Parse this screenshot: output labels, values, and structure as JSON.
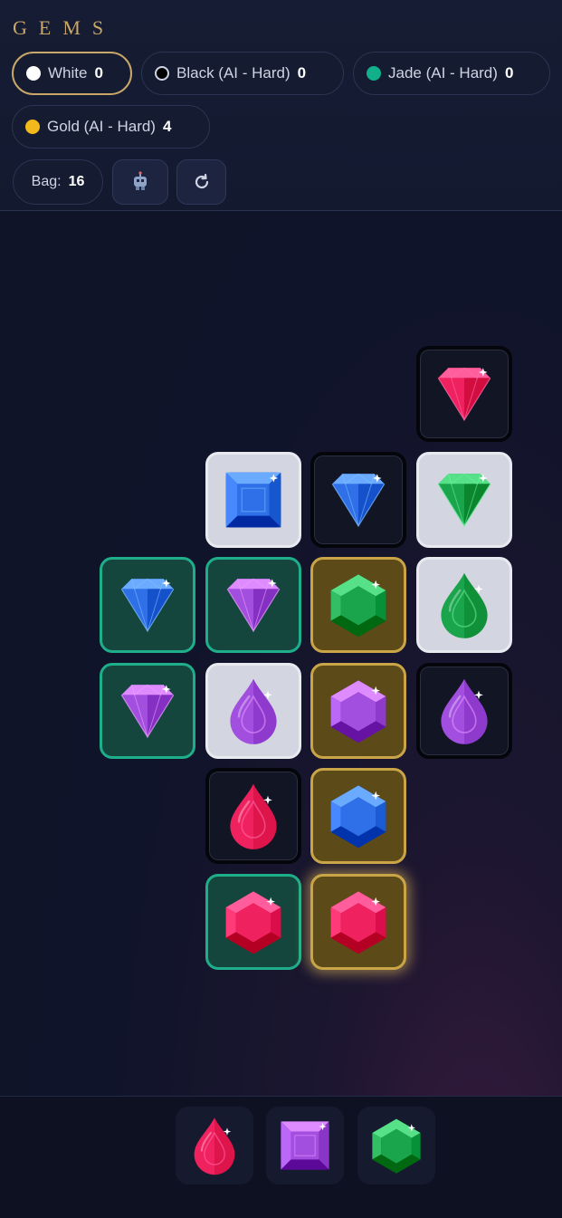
{
  "game": {
    "title": "GEMS"
  },
  "players": [
    {
      "name": "White",
      "score": "0",
      "color": "#ffffff",
      "active": true
    },
    {
      "name": "Black (AI - Hard)",
      "score": "0",
      "color": "#000000",
      "active": false
    },
    {
      "name": "Jade (AI - Hard)",
      "score": "0",
      "color": "#12b08a",
      "active": false
    },
    {
      "name": "Gold (AI - Hard)",
      "score": "4",
      "color": "#f2b91c",
      "active": false
    }
  ],
  "bag": {
    "label": "Bag:",
    "count": "16"
  },
  "controls": {
    "robot_icon": "robot-icon",
    "restart_icon": "restart-icon"
  },
  "board": {
    "tiles": [
      {
        "row": 0,
        "col": 3,
        "owner": "black",
        "gem": "diamond",
        "color": "red"
      },
      {
        "row": 1,
        "col": 1,
        "owner": "white",
        "gem": "square",
        "color": "blue"
      },
      {
        "row": 1,
        "col": 2,
        "owner": "black",
        "gem": "diamond",
        "color": "blue"
      },
      {
        "row": 1,
        "col": 3,
        "owner": "white",
        "gem": "diamond",
        "color": "green"
      },
      {
        "row": 2,
        "col": 0,
        "owner": "jade",
        "gem": "diamond",
        "color": "blue"
      },
      {
        "row": 2,
        "col": 1,
        "owner": "jade",
        "gem": "diamond",
        "color": "purple"
      },
      {
        "row": 2,
        "col": 2,
        "owner": "gold",
        "gem": "hexagon",
        "color": "green"
      },
      {
        "row": 2,
        "col": 3,
        "owner": "white",
        "gem": "drop",
        "color": "green"
      },
      {
        "row": 3,
        "col": 0,
        "owner": "jade",
        "gem": "diamond",
        "color": "purple"
      },
      {
        "row": 3,
        "col": 1,
        "owner": "white",
        "gem": "drop",
        "color": "purple"
      },
      {
        "row": 3,
        "col": 2,
        "owner": "gold",
        "gem": "hexagon",
        "color": "purple"
      },
      {
        "row": 3,
        "col": 3,
        "owner": "black",
        "gem": "drop",
        "color": "purple"
      },
      {
        "row": 4,
        "col": 1,
        "owner": "black",
        "gem": "drop",
        "color": "red"
      },
      {
        "row": 4,
        "col": 2,
        "owner": "gold",
        "gem": "hexagon",
        "color": "blue"
      },
      {
        "row": 5,
        "col": 1,
        "owner": "jade",
        "gem": "hexagon",
        "color": "red"
      },
      {
        "row": 5,
        "col": 2,
        "owner": "gold",
        "gem": "hexagon",
        "color": "red",
        "highlighted": true
      }
    ]
  },
  "hand": [
    {
      "gem": "drop",
      "color": "red"
    },
    {
      "gem": "square",
      "color": "purple"
    },
    {
      "gem": "hexagon",
      "color": "green"
    }
  ],
  "gem_colors": {
    "red": "#f0215f",
    "blue": "#2f6fe8",
    "green": "#1aa44c",
    "purple": "#a24fe0"
  }
}
